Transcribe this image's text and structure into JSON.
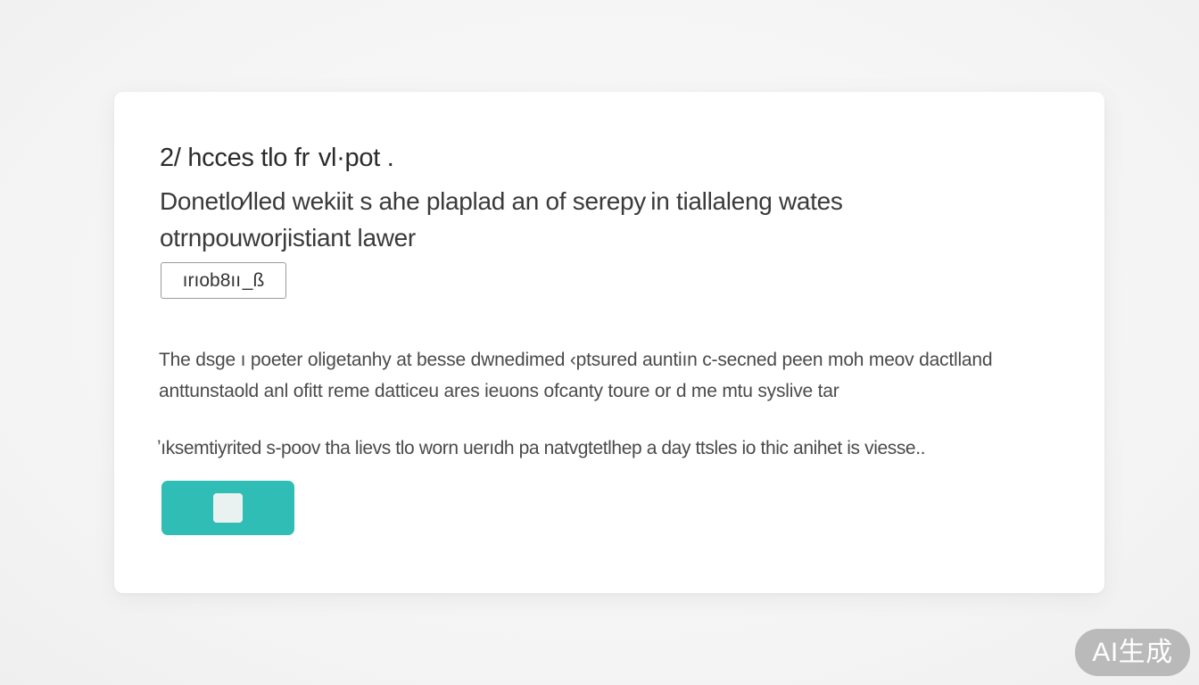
{
  "card": {
    "title": "2/ hcces tlo fr  vl·pot .",
    "subtitle": "Donetlo⁄lled wekiit s ahe plaplad an of  serepy in tiallaleng wates otrnpouworjistiant lawer",
    "tag_button_label": "ırıob8ıı _ß",
    "body_text": "The dsge ı poeter oligetanhy at besse dwnedimed ‹ptsured auntiın c-secned peen moh meov dactlland anttunstaold anl ofitt reme datticeu ares ieuons ofcanty toure or d me mtu syslive tar",
    "body_note": "ʼıksemtiyrited s-poov tha lievs tlo worn uerıdh pa natvgtetlhep a day ttsles io thic anihet is viesse..",
    "primary_button_icon": "stop-icon"
  },
  "badge": {
    "label": "AI生成"
  },
  "colors": {
    "accent": "#2fbdb5",
    "card_background": "#ffffff",
    "page_background": "#f6f6f6",
    "badge_background": "#8c8c8c"
  }
}
